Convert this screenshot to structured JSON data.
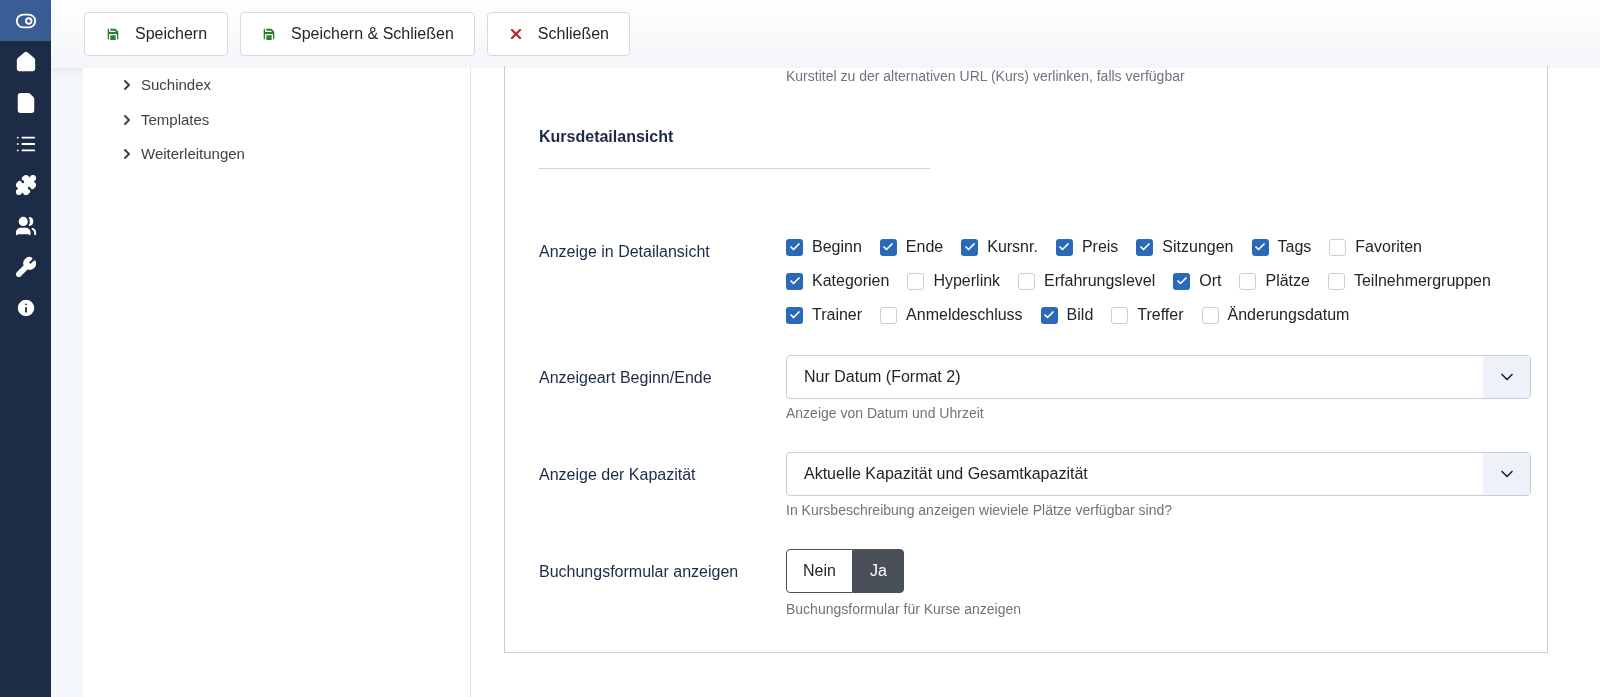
{
  "sidebar": {
    "items": [
      {
        "selected": true
      },
      {
        "selected": false
      },
      {
        "selected": false
      },
      {
        "selected": false
      },
      {
        "selected": false
      },
      {
        "selected": false
      },
      {
        "selected": false
      },
      {
        "selected": false
      }
    ]
  },
  "toolbar": {
    "buttons": [
      {
        "label": "Speichern",
        "kind": "save"
      },
      {
        "label": "Speichern & Schließen",
        "kind": "save"
      },
      {
        "label": "Schließen",
        "kind": "close"
      }
    ]
  },
  "tree": {
    "items": [
      {
        "label": "Suchindex",
        "expanded": false
      },
      {
        "label": "Templates",
        "expanded": false
      },
      {
        "label": "Weiterleitungen",
        "expanded": false
      }
    ]
  },
  "top_hint": "Kurstitel zu der alternativen URL (Kurs) verlinken, falls verfügbar",
  "section_title": "Kursdetailansicht",
  "fields": [
    {
      "kind": "checkboxes",
      "label": "Anzeige in Detailansicht",
      "options": [
        {
          "label": "Beginn",
          "checked": true
        },
        {
          "label": "Ende",
          "checked": true
        },
        {
          "label": "Kursnr.",
          "checked": true
        },
        {
          "label": "Preis",
          "checked": true
        },
        {
          "label": "Sitzungen",
          "checked": true
        },
        {
          "label": "Tags",
          "checked": true
        },
        {
          "label": "Favoriten",
          "checked": false
        },
        {
          "label": "Kategorien",
          "checked": true
        },
        {
          "label": "Hyperlink",
          "checked": false
        },
        {
          "label": "Erfahrungslevel",
          "checked": false
        },
        {
          "label": "Ort",
          "checked": true
        },
        {
          "label": "Plätze",
          "checked": false
        },
        {
          "label": "Teilnehmergruppen",
          "checked": false
        },
        {
          "label": "Trainer",
          "checked": true
        },
        {
          "label": "Anmeldeschluss",
          "checked": false
        },
        {
          "label": "Bild",
          "checked": true
        },
        {
          "label": "Treffer",
          "checked": false
        },
        {
          "label": "Änderungsdatum",
          "checked": false
        }
      ]
    },
    {
      "kind": "select",
      "label": "Anzeigeart Beginn/Ende",
      "value": "Nur Datum (Format 2)",
      "hint": "Anzeige von Datum und Uhrzeit"
    },
    {
      "kind": "select",
      "label": "Anzeige der Kapazität",
      "value": "Aktuelle Kapazität und Gesamtkapazität",
      "hint": "In Kursbeschreibung anzeigen wieviele Plätze verfügbar sind?"
    },
    {
      "kind": "switcher",
      "label": "Buchungsformular anzeigen",
      "options": [
        {
          "label": "Nein",
          "selected": false
        },
        {
          "label": "Ja",
          "selected": true
        }
      ],
      "hint": "Buchungsformular für Kurse anzeigen"
    }
  ]
}
